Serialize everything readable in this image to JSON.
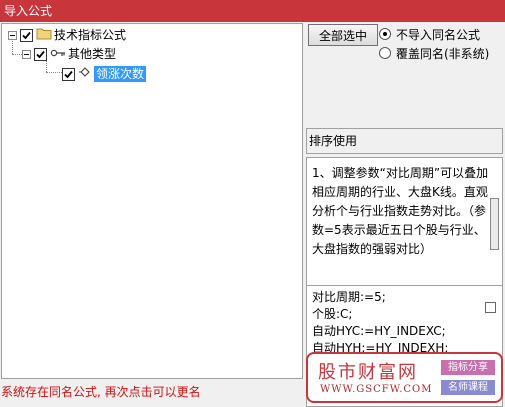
{
  "window": {
    "title": "导入公式"
  },
  "tree": {
    "nodes": [
      {
        "label": "技术指标公式",
        "checked": true
      },
      {
        "label": "其他类型",
        "checked": true
      },
      {
        "label": "领涨次数",
        "checked": true,
        "selected": true
      }
    ]
  },
  "options": {
    "select_all_label": "全部选中",
    "radios": [
      {
        "label": "不导入同名公式",
        "selected": true
      },
      {
        "label": "覆盖同名(非系统)",
        "selected": false
      }
    ]
  },
  "sort_label": "排序使用",
  "description": "1、调整参数“对比周期”可以叠加相应周期的行业、大盘K线。直观分析个与行业指数走势对比。（参数=5表示最近五日个股与行业、大盘指数的强弱对比）",
  "code_lines": [
    "对比周期:=5;",
    "个股:C;",
    "自动HYC:=HY_INDEXC;",
    "自动HYH:=HY_INDEXH;"
  ],
  "status_text": "系统存在同名公式, 再次点击可以更名",
  "watermark": {
    "brand": "股市财富网",
    "url": "WWW.GSCFW.COM",
    "badge_1": "指标分享",
    "badge_2": "名师课程"
  },
  "colors": {
    "title_bar": "#c8363b",
    "selection": "#3399ff",
    "status": "#d01010"
  }
}
